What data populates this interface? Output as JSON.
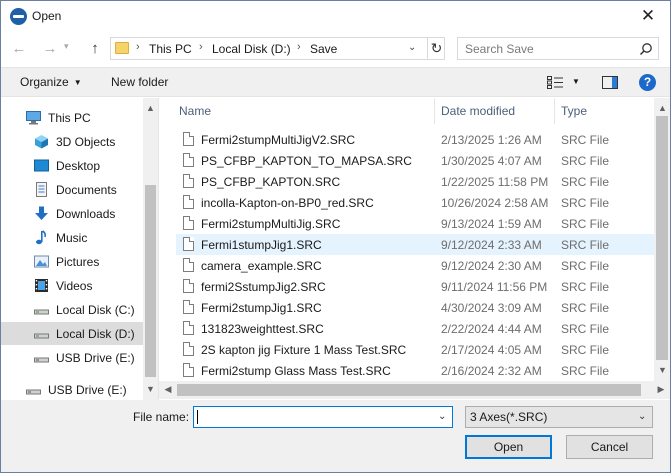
{
  "window": {
    "title": "Open",
    "close_icon": "close-icon"
  },
  "address_bar": {
    "crumbs": [
      "This PC",
      "Local Disk (D:)",
      "Save"
    ],
    "search_placeholder": "Search Save"
  },
  "toolbar": {
    "organize": "Organize",
    "new_folder": "New folder",
    "help": "?"
  },
  "nav": {
    "items": [
      {
        "label": "This PC",
        "icon": "monitor-icon"
      },
      {
        "label": "3D Objects",
        "icon": "cube-icon"
      },
      {
        "label": "Desktop",
        "icon": "desktop-icon"
      },
      {
        "label": "Documents",
        "icon": "documents-icon"
      },
      {
        "label": "Downloads",
        "icon": "download-arrow-icon"
      },
      {
        "label": "Music",
        "icon": "music-note-icon"
      },
      {
        "label": "Pictures",
        "icon": "pictures-icon"
      },
      {
        "label": "Videos",
        "icon": "film-icon"
      },
      {
        "label": "Local Disk (C:)",
        "icon": "drive-icon"
      },
      {
        "label": "Local Disk (D:)",
        "icon": "drive-icon",
        "selected": true
      },
      {
        "label": "USB Drive (E:)",
        "icon": "usb-drive-icon"
      },
      {
        "label": "USB Drive (E:)",
        "icon": "usb-drive-icon"
      }
    ]
  },
  "columns": {
    "name": "Name",
    "date": "Date modified",
    "type": "Type"
  },
  "files": [
    {
      "name": "Fermi2stumpMultiJigV2.SRC",
      "date": "2/13/2025 1:26 AM",
      "type": "SRC File"
    },
    {
      "name": "PS_CFBP_KAPTON_TO_MAPSA.SRC",
      "date": "1/30/2025 4:07 AM",
      "type": "SRC File"
    },
    {
      "name": "PS_CFBP_KAPTON.SRC",
      "date": "1/22/2025 11:58 PM",
      "type": "SRC File"
    },
    {
      "name": "incolla-Kapton-on-BP0_red.SRC",
      "date": "10/26/2024 2:58 AM",
      "type": "SRC File"
    },
    {
      "name": "Fermi2stumpMultiJig.SRC",
      "date": "9/13/2024 1:59 AM",
      "type": "SRC File"
    },
    {
      "name": "Fermi1stumpJig1.SRC",
      "date": "9/12/2024 2:33 AM",
      "type": "SRC File",
      "hover": true
    },
    {
      "name": "camera_example.SRC",
      "date": "9/12/2024 2:30 AM",
      "type": "SRC File"
    },
    {
      "name": "fermi2SstumpJig2.SRC",
      "date": "9/11/2024 11:56 PM",
      "type": "SRC File"
    },
    {
      "name": "Fermi2stumpJig1.SRC",
      "date": "4/30/2024 3:09 AM",
      "type": "SRC File"
    },
    {
      "name": "131823weighttest.SRC",
      "date": "2/22/2024 4:44 AM",
      "type": "SRC File"
    },
    {
      "name": "2S kapton jig Fixture 1 Mass Test.SRC",
      "date": "2/17/2024 4:05 AM",
      "type": "SRC File"
    },
    {
      "name": "Fermi2stump Glass Mass Test.SRC",
      "date": "2/16/2024 2:32 AM",
      "type": "SRC File"
    }
  ],
  "bottom": {
    "file_name_label": "File name:",
    "file_name_value": "",
    "file_type": "3 Axes(*.SRC)",
    "open": "Open",
    "cancel": "Cancel"
  },
  "colors": {
    "accent": "#0078d7",
    "hover_row": "#e5f3ff",
    "selected_nav": "#dcdcdc"
  }
}
